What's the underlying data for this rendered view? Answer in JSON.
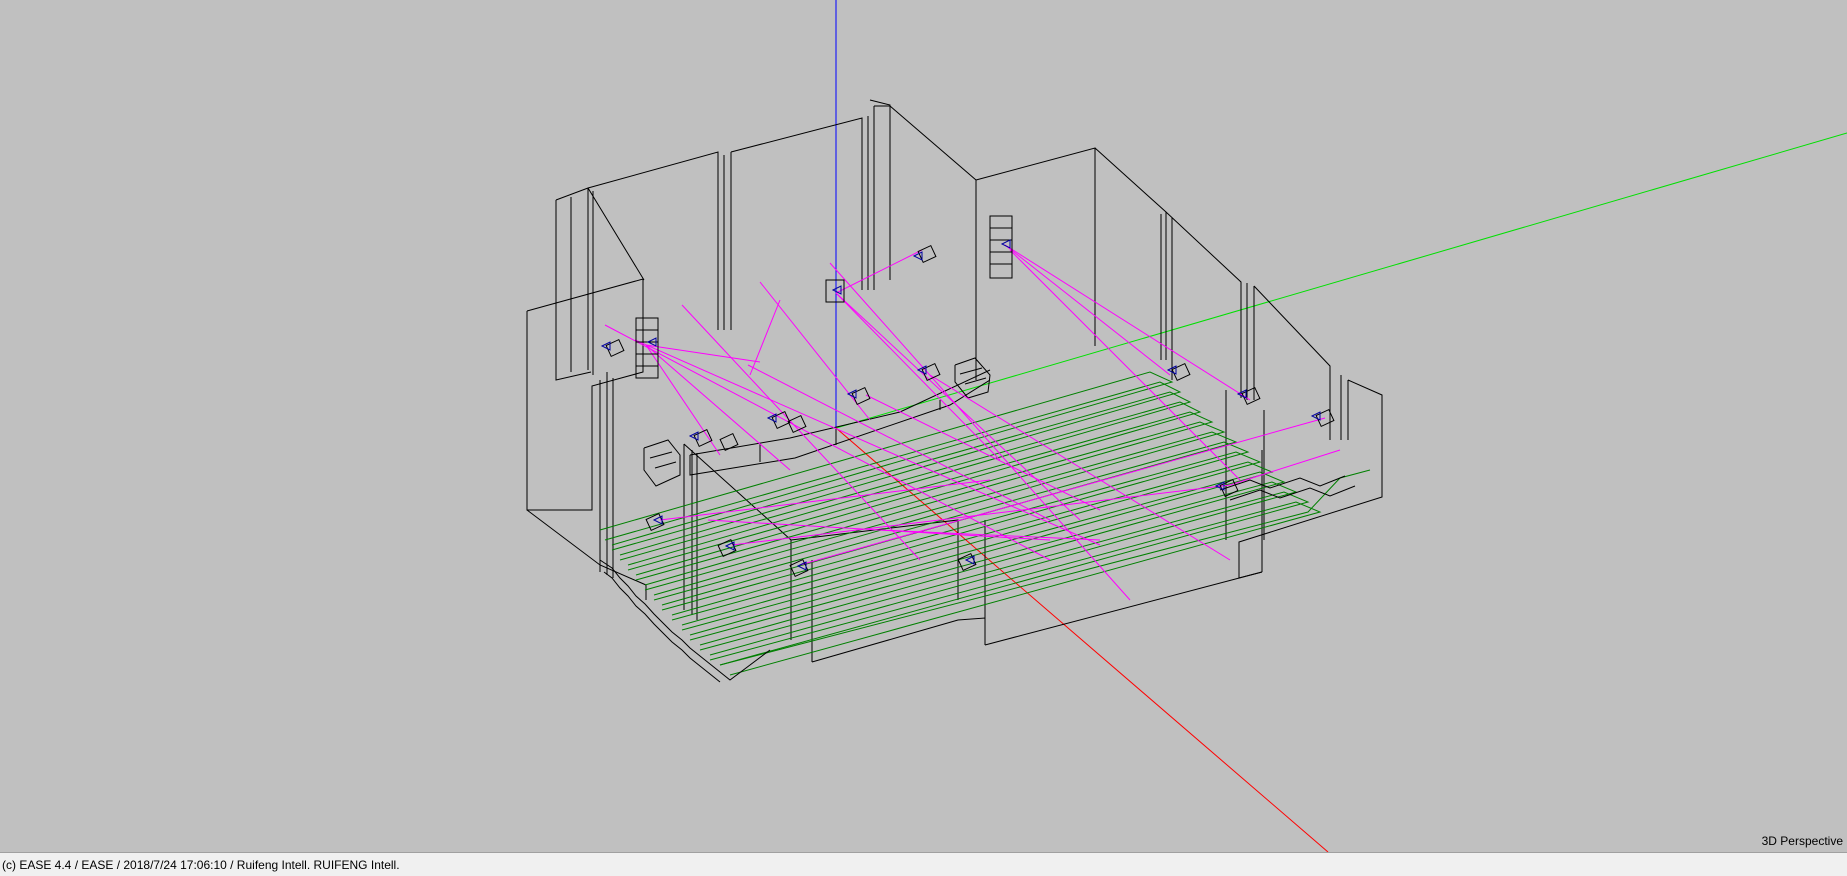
{
  "viewport": {
    "view_mode_label": "3D Perspective"
  },
  "status_bar": {
    "text": "(c) EASE 4.4  / EASE  / 2018/7/24 17:06:10 / Ruifeng Intell. RUIFENG Intell."
  },
  "colors": {
    "background": "#c0c0c0",
    "wireframe": "#000000",
    "axis_x": "#ff0000",
    "axis_y": "#00e000",
    "axis_z": "#0000ff",
    "seating": "#008000",
    "aiming_lines": "#ff00ff",
    "speaker": "#0000a0"
  }
}
